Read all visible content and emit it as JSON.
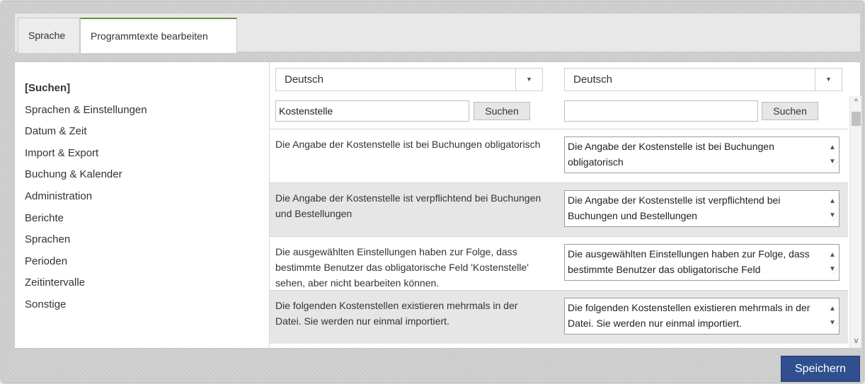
{
  "tabs": [
    {
      "label": "Sprache"
    },
    {
      "label": "Programmtexte bearbeiten"
    }
  ],
  "sidebar": {
    "items": [
      {
        "label": "[Suchen]"
      },
      {
        "label": "Sprachen & Einstellungen"
      },
      {
        "label": "Datum & Zeit"
      },
      {
        "label": "Import & Export"
      },
      {
        "label": "Buchung & Kalender"
      },
      {
        "label": "Administration"
      },
      {
        "label": "Berichte"
      },
      {
        "label": "Sprachen"
      },
      {
        "label": "Perioden"
      },
      {
        "label": "Zeitintervalle"
      },
      {
        "label": "Sonstige"
      }
    ]
  },
  "left": {
    "language": "Deutsch",
    "search_value": "Kostenstelle",
    "search_button": "Suchen"
  },
  "right": {
    "language": "Deutsch",
    "search_value": "",
    "search_button": "Suchen"
  },
  "rows": [
    {
      "source": "Die Angabe der Kostenstelle ist bei Buchungen obligatorisch",
      "target": "Die Angabe der Kostenstelle ist bei Buchungen obligatorisch"
    },
    {
      "source": "Die Angabe der Kostenstelle ist verpflichtend bei Buchungen und Bestellungen",
      "target": "Die Angabe der Kostenstelle ist verpflichtend bei Buchungen und Bestellungen"
    },
    {
      "source": "Die ausgewählten Einstellungen haben zur Folge, dass bestimmte Benutzer das obligatorische Feld 'Kostenstelle' sehen, aber nicht bearbeiten können.",
      "target": "Die ausgewählten Einstellungen haben zur Folge, dass bestimmte Benutzer das obligatorische Feld"
    },
    {
      "source": "Die folgenden Kostenstellen existieren mehrmals in der Datei. Sie werden nur einmal importiert.",
      "target": "Die folgenden Kostenstellen existieren mehrmals in der Datei. Sie werden nur einmal importiert."
    }
  ],
  "footer": {
    "save_label": "Speichern"
  }
}
